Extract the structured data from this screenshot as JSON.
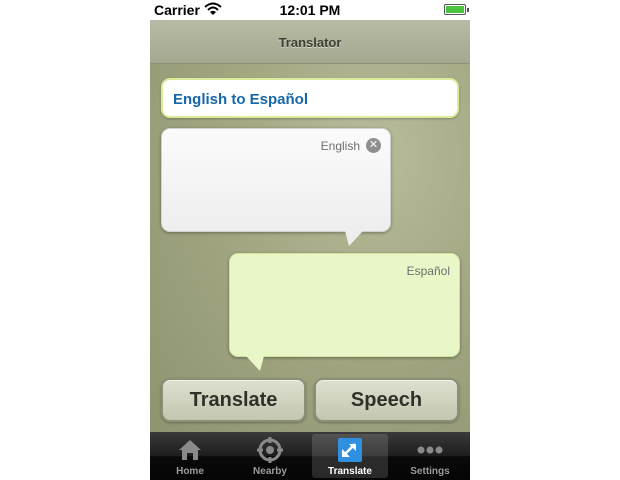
{
  "status_bar": {
    "carrier": "Carrier",
    "time": "12:01 PM",
    "battery_level": 1.0
  },
  "nav": {
    "title": "Translator"
  },
  "language_pair": "English to Español",
  "source": {
    "language": "English",
    "text": ""
  },
  "target": {
    "language": "Español",
    "text": ""
  },
  "buttons": {
    "translate": "Translate",
    "speech": "Speech"
  },
  "tabs": [
    {
      "label": "Home",
      "icon": "home-icon",
      "selected": false
    },
    {
      "label": "Nearby",
      "icon": "crosshair-icon",
      "selected": false
    },
    {
      "label": "Translate",
      "icon": "translate-icon",
      "selected": true
    },
    {
      "label": "Settings",
      "icon": "more-icon",
      "selected": false
    }
  ],
  "colors": {
    "accent_text": "#1767a8",
    "target_bubble": "#e8f6c8",
    "field_border": "#d9ec9a"
  }
}
